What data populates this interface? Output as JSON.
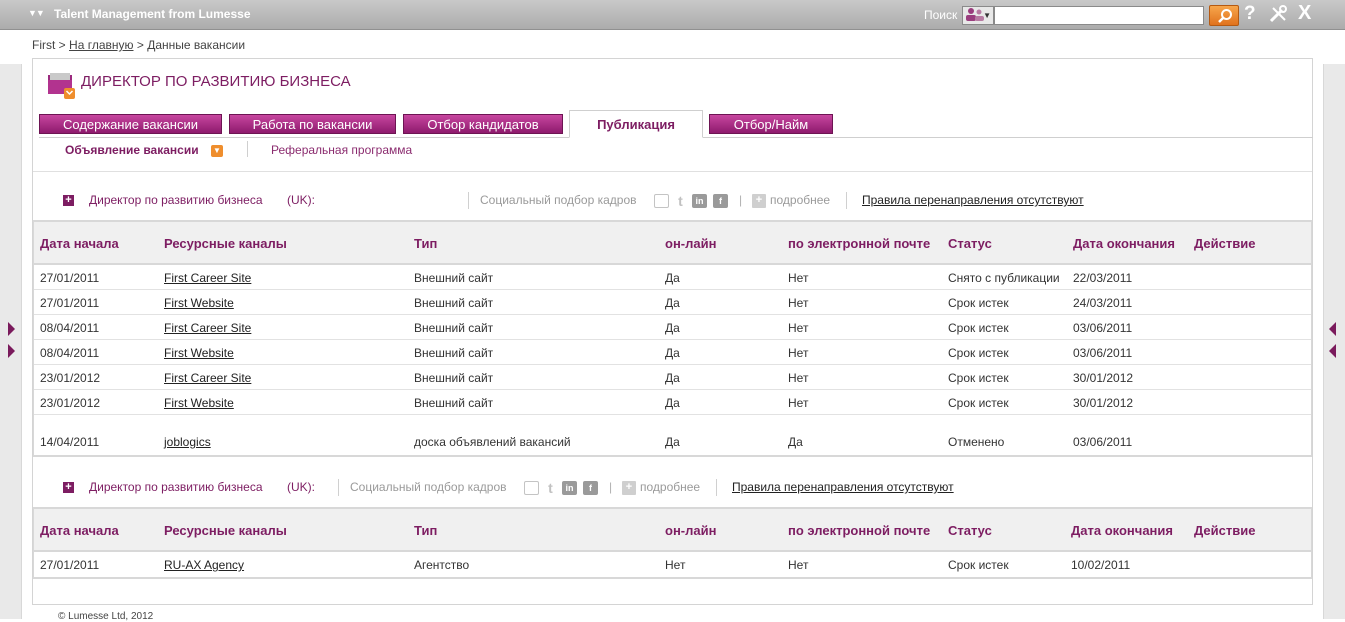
{
  "topbar": {
    "app_title": "Talent Management from Lumesse",
    "search_label": "Поиск",
    "search_value": "",
    "help_glyph": "?",
    "close_glyph": "X"
  },
  "breadcrumb": {
    "home": "First",
    "sep1": ">",
    "main": "На главную",
    "sep2": ">",
    "current": "Данные вакансии"
  },
  "job": {
    "title": "ДИРЕКТОР ПО РАЗВИТИЮ БИЗНЕСА"
  },
  "tabs": [
    {
      "label": "Содержание вакансии"
    },
    {
      "label": "Работа по вакансии"
    },
    {
      "label": "Отбор кандидатов"
    },
    {
      "label": "Публикация"
    },
    {
      "label": "Отбор/Найм"
    }
  ],
  "subnav": {
    "active": "Объявление вакансии",
    "other": "Реферальная программа"
  },
  "columns": [
    "Дата начала",
    "Ресурсные каналы",
    "Тип",
    "он-лайн",
    "по электронной почте",
    "Статус",
    "Дата окончания",
    "Действие"
  ],
  "sections": [
    {
      "title": "Директор по развитию бизнеса",
      "country": "(UK):",
      "social_label": "Социальный подбор кадров",
      "pipe": "|",
      "more_label": "подробнее",
      "redirect_label": "Правила перенаправления отсутствуют",
      "rows": [
        {
          "start": "27/01/2011",
          "channel": "First Career Site",
          "type": "Внешний сайт",
          "online": "Да",
          "email": "Нет",
          "status": "Снято с публикации",
          "end": "22/03/2011"
        },
        {
          "start": "27/01/2011",
          "channel": "First Website",
          "type": "Внешний сайт",
          "online": "Да",
          "email": "Нет",
          "status": "Срок истек",
          "end": "24/03/2011"
        },
        {
          "start": "08/04/2011",
          "channel": "First Career Site",
          "type": "Внешний сайт",
          "online": "Да",
          "email": "Нет",
          "status": "Срок истек",
          "end": "03/06/2011"
        },
        {
          "start": "08/04/2011",
          "channel": "First Website",
          "type": "Внешний сайт",
          "online": "Да",
          "email": "Нет",
          "status": "Срок истек",
          "end": "03/06/2011"
        },
        {
          "start": "23/01/2012",
          "channel": "First Career Site",
          "type": "Внешний сайт",
          "online": "Да",
          "email": "Нет",
          "status": "Срок истек",
          "end": "30/01/2012"
        },
        {
          "start": "23/01/2012",
          "channel": "First Website",
          "type": "Внешний сайт",
          "online": "Да",
          "email": "Нет",
          "status": "Срок истек",
          "end": "30/01/2012"
        },
        {
          "start": "14/04/2011",
          "channel": "joblogics",
          "type": "доска объявлений вакансий",
          "online": "Да",
          "email": "Да",
          "status": "Отменено",
          "end": "03/06/2011"
        }
      ]
    },
    {
      "title": "Директор по развитию бизнеса",
      "country": "(UK):",
      "social_label": "Социальный подбор кадров",
      "pipe": "|",
      "more_label": "подробнее",
      "redirect_label": "Правила перенаправления отсутствуют",
      "rows": [
        {
          "start": "27/01/2011",
          "channel": "RU-AX Agency",
          "type": "Агентство",
          "online": "Нет",
          "email": "Нет",
          "status": "Срок истек",
          "end": "10/02/2011"
        }
      ]
    }
  ],
  "footer": {
    "copyright": "© Lumesse Ltd, 2012"
  },
  "colors": {
    "brand": "#7d1d62",
    "tab": "#a8287f",
    "accent": "#ef8e2d"
  }
}
